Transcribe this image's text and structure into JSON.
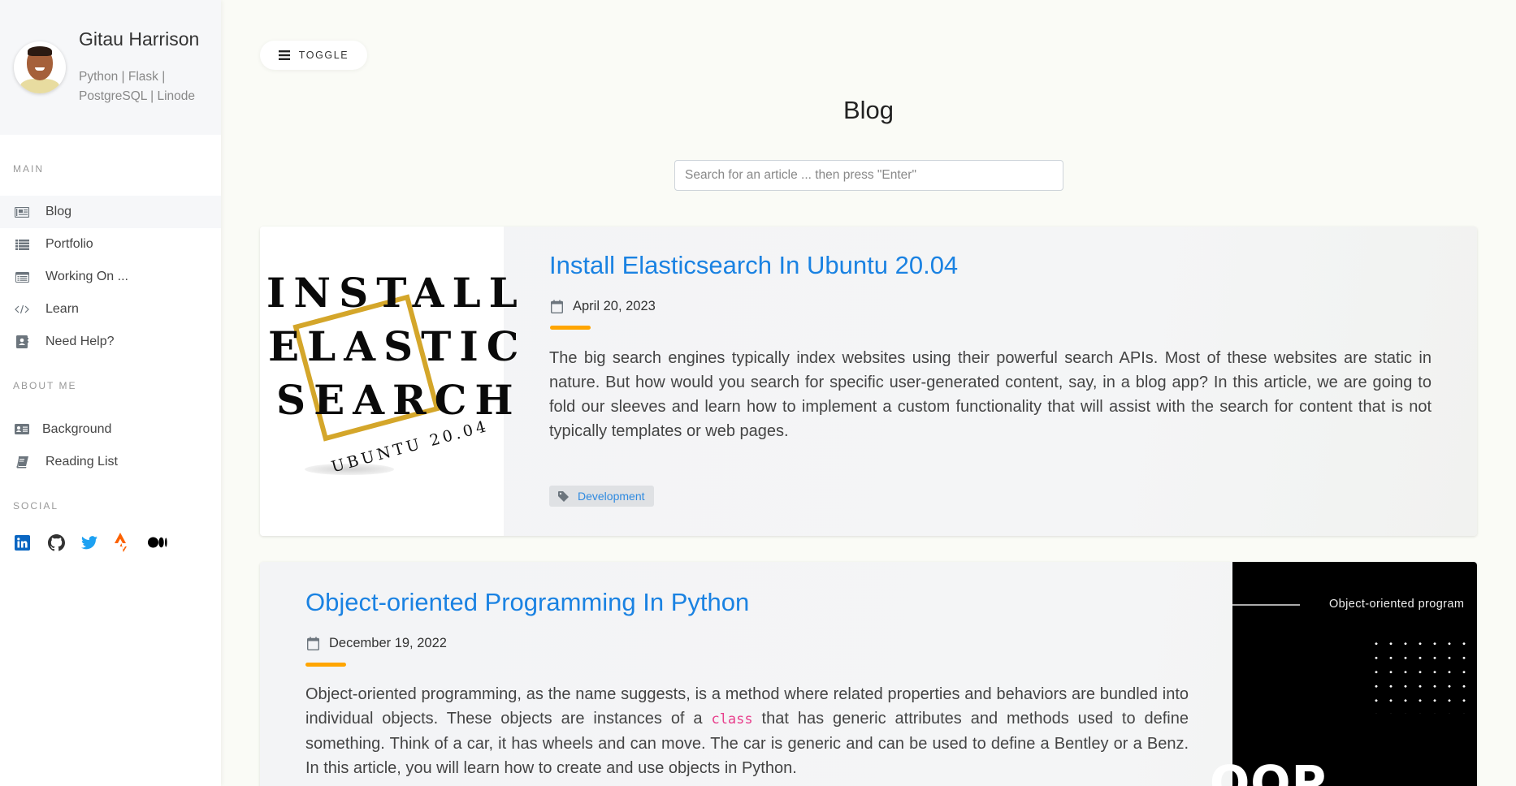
{
  "profile": {
    "name": "Gitau Harrison",
    "tagline": "Python | Flask | PostgreSQL | Linode"
  },
  "sidebar": {
    "sections": {
      "main": "MAIN",
      "about": "ABOUT ME",
      "social": "SOCIAL"
    },
    "main_items": [
      {
        "label": "Blog",
        "icon": "newspaper-icon",
        "active": true
      },
      {
        "label": "Portfolio",
        "icon": "list-icon"
      },
      {
        "label": "Working On ...",
        "icon": "window-list-icon"
      },
      {
        "label": "Learn",
        "icon": "code-icon"
      },
      {
        "label": "Need Help?",
        "icon": "address-book-icon"
      }
    ],
    "about_items": [
      {
        "label": "Background",
        "icon": "id-card-icon"
      },
      {
        "label": "Reading List",
        "icon": "book-icon"
      }
    ],
    "social_items": [
      {
        "name": "LinkedIn",
        "icon": "linkedin-icon",
        "color": "#0a66c2"
      },
      {
        "name": "GitHub",
        "icon": "github-icon",
        "color": "#333333"
      },
      {
        "name": "Twitter",
        "icon": "twitter-icon",
        "color": "#1da1f2"
      },
      {
        "name": "Strava",
        "icon": "strava-icon",
        "color": "#fc6100"
      },
      {
        "name": "Medium",
        "icon": "medium-icon",
        "color": "#000000"
      }
    ]
  },
  "toolbar": {
    "toggle_label": "TOGGLE"
  },
  "page": {
    "title": "Blog",
    "search_placeholder": "Search for an article ... then press \"Enter\""
  },
  "posts": [
    {
      "title": "Install Elasticsearch In Ubuntu 20.04",
      "date": "April 20, 2023",
      "excerpt": "The big search engines typically index websites using their powerful search APIs. Most of these websites are static in nature. But how would you search for specific user-generated content, say, in a blog app? In this article, we are going to fold our sleeves and learn how to implement a custom functionality that will assist with the search for content that is not typically templates or web pages.",
      "tag": "Development",
      "image": {
        "lines": [
          "INSTALL",
          "ELASTIC",
          "SEARCH"
        ],
        "subtitle": "UBUNTU 20.04"
      }
    },
    {
      "title": "Object-oriented Programming In Python",
      "date": "December 19, 2022",
      "excerpt_before": "Object-oriented programming, as the name suggests, is a method where related properties and behaviors are bundled into individual objects. These objects are instances of a ",
      "excerpt_code": "class",
      "excerpt_after": " that has generic attributes and methods used to define something. Think of a car, it has wheels and can move. The car is generic and can be used to define a Bentley or a Benz. In this article, you will learn how to create and use objects in Python.",
      "image": {
        "caption": "Object-oriented program",
        "big_text": "OOP"
      }
    }
  ],
  "colors": {
    "link": "#1a82e2",
    "accent_underline": "#ffa500",
    "code": "#e83e8c"
  }
}
